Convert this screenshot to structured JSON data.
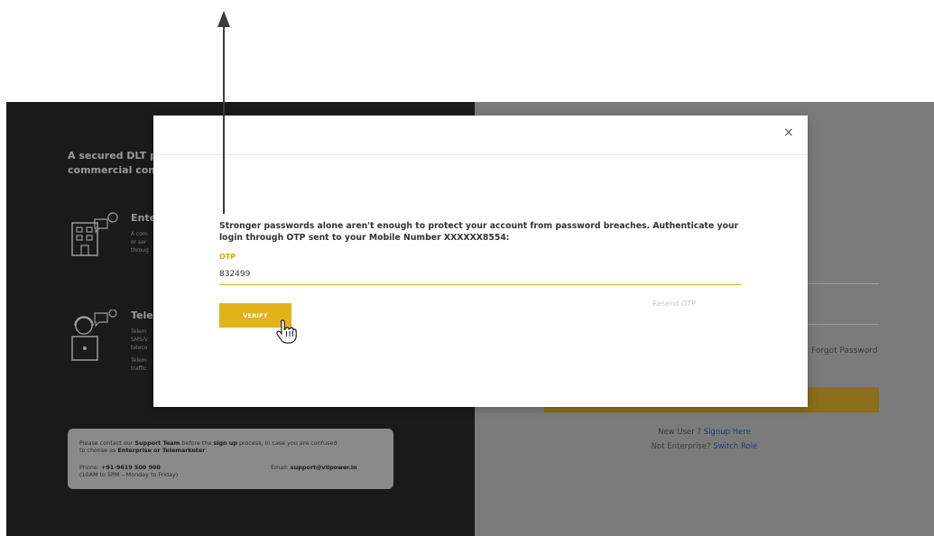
{
  "left_panel": {
    "tagline_line1": "A secured DLT pla",
    "tagline_line2": "commercial comm",
    "enterprise": {
      "title": "Ente",
      "desc_line1": "A com",
      "desc_line2": "or ser",
      "desc_line3": "throug"
    },
    "telemarketer": {
      "title": "Tele",
      "desc_line1": "Telem",
      "desc_line2": "SMS/V",
      "desc_line3": "teleco",
      "desc_line4": "Telem",
      "desc_line5": "traffic"
    },
    "support": {
      "line1_a": "Please contact our ",
      "line1_b": "Support Team",
      "line1_c": " before the ",
      "line1_d": "sign up",
      "line1_e": " process, in case you are confused",
      "line2_a": "to choose as ",
      "line2_b": "Enterprise or Telemarketer",
      "line2_c": ".",
      "phone_label": "Phone: ",
      "phone_value": "+91-9619 500 900",
      "hours": "(10AM to 5PM – Monday to Friday)",
      "email_label": "Email: ",
      "email_value": "support@vilpower.in"
    }
  },
  "right_panel": {
    "forgot_password": "Forgot Password",
    "new_user_text": "New User ? ",
    "signup_link": "Signup Here",
    "not_enterprise_text": "Not Enterprise? ",
    "switch_role_link": "Switch Role"
  },
  "modal": {
    "close_label": "×",
    "message": "Stronger passwords alone aren't enough to protect your account from password breaches. Authenticate your login through OTP sent to your Mobile Number XXXXXX8554:",
    "otp_label": "OTP",
    "otp_value": "832499",
    "resend_label": "Resend OTP",
    "verify_label": "VERIFY"
  },
  "colors": {
    "accent": "#e3b21b",
    "dark_panel": "#1a1a1a",
    "overlay_gray": "#7b7b7b",
    "link": "#1c3d75"
  }
}
